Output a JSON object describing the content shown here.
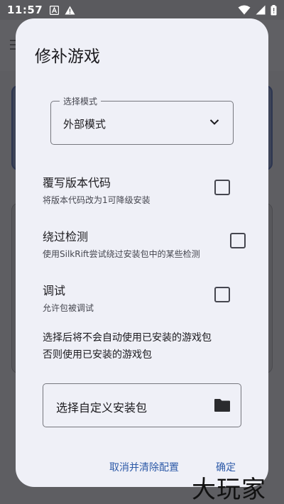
{
  "status_bar": {
    "time": "11:57",
    "left_icons": [
      "app-notification-icon",
      "warning-icon"
    ],
    "right_icons": [
      "wifi-icon",
      "signal-icon",
      "battery-icon"
    ]
  },
  "dialog": {
    "title": "修补游戏",
    "mode_select": {
      "label": "选择模式",
      "value": "外部模式"
    },
    "options": [
      {
        "title": "覆写版本代码",
        "desc": "将版本代码改为1可降级安装",
        "checked": false
      },
      {
        "title": "绕过检测",
        "desc": "使用SilkRift尝试绕过安装包中的某些检测",
        "checked": false
      },
      {
        "title": "调试",
        "desc": "允许包被调试",
        "checked": false
      }
    ],
    "notice_lines": [
      "选择后将不会自动使用已安装的游戏包",
      "否则使用已安装的游戏包"
    ],
    "custom_package_label": "选择自定义安装包",
    "actions": {
      "cancel": "取消并清除配置",
      "confirm": "确定"
    }
  },
  "watermark": "大玩家",
  "colors": {
    "dialog_bg": "#eff0f7",
    "accent": "#2d5aa8",
    "scrim": "#5e5e62"
  }
}
